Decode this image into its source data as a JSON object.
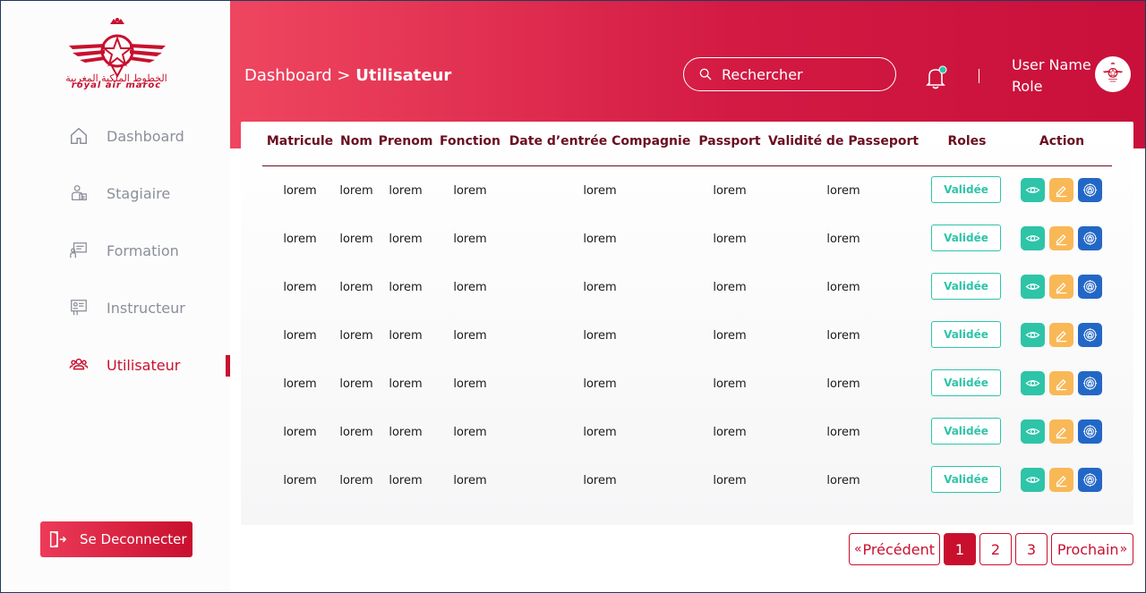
{
  "brand": {
    "name": "royal air maroc",
    "name_ar": "الخطوط الملكية المغربية"
  },
  "sidebar": {
    "items": [
      {
        "label": "Dashboard",
        "icon": "home-icon",
        "active": false
      },
      {
        "label": "Stagiaire",
        "icon": "trainee-icon",
        "active": false
      },
      {
        "label": "Formation",
        "icon": "formation-icon",
        "active": false
      },
      {
        "label": "Instructeur",
        "icon": "instructor-icon",
        "active": false
      },
      {
        "label": "Utilisateur",
        "icon": "users-icon",
        "active": true
      }
    ],
    "logout_label": "Se Deconnecter"
  },
  "header": {
    "breadcrumb_parent": "Dashboard",
    "breadcrumb_separator": ">",
    "breadcrumb_current": "Utilisateur",
    "search_placeholder": "Rechercher",
    "user_name": "User Name",
    "user_role": "Role",
    "divider": "|"
  },
  "table": {
    "columns": [
      "Matricule",
      "Nom",
      "Prenom",
      "Fonction",
      "Date d’entrée Compagnie",
      "Passport",
      "Validité de Passeport",
      "Roles",
      "Action"
    ],
    "rows": [
      {
        "matricule": "lorem",
        "nom": "lorem",
        "prenom": "lorem",
        "fonction": "lorem",
        "date": "lorem",
        "passport": "lorem",
        "validite": "lorem",
        "role": "Validée"
      },
      {
        "matricule": "lorem",
        "nom": "lorem",
        "prenom": "lorem",
        "fonction": "lorem",
        "date": "lorem",
        "passport": "lorem",
        "validite": "lorem",
        "role": "Validée"
      },
      {
        "matricule": "lorem",
        "nom": "lorem",
        "prenom": "lorem",
        "fonction": "lorem",
        "date": "lorem",
        "passport": "lorem",
        "validite": "lorem",
        "role": "Validée"
      },
      {
        "matricule": "lorem",
        "nom": "lorem",
        "prenom": "lorem",
        "fonction": "lorem",
        "date": "lorem",
        "passport": "lorem",
        "validite": "lorem",
        "role": "Validée"
      },
      {
        "matricule": "lorem",
        "nom": "lorem",
        "prenom": "lorem",
        "fonction": "lorem",
        "date": "lorem",
        "passport": "lorem",
        "validite": "lorem",
        "role": "Validée"
      },
      {
        "matricule": "lorem",
        "nom": "lorem",
        "prenom": "lorem",
        "fonction": "lorem",
        "date": "lorem",
        "passport": "lorem",
        "validite": "lorem",
        "role": "Validée"
      },
      {
        "matricule": "lorem",
        "nom": "lorem",
        "prenom": "lorem",
        "fonction": "lorem",
        "date": "lorem",
        "passport": "lorem",
        "validite": "lorem",
        "role": "Validée"
      }
    ],
    "action_icons": [
      "eye-icon",
      "pencil-icon",
      "permission-icon"
    ]
  },
  "pagination": {
    "prev_label": "Précédent",
    "next_label": "Prochain",
    "pages": [
      "1",
      "2",
      "3"
    ],
    "current": "1"
  },
  "colors": {
    "brand_red": "#c8102e",
    "header_gradient_start": "#ef4660",
    "header_gradient_end": "#c8103a",
    "teal": "#2ec4a8",
    "orange": "#f9b856",
    "blue": "#2367c6",
    "nav_inactive": "#8a8f99",
    "table_header": "#6a0f22"
  }
}
